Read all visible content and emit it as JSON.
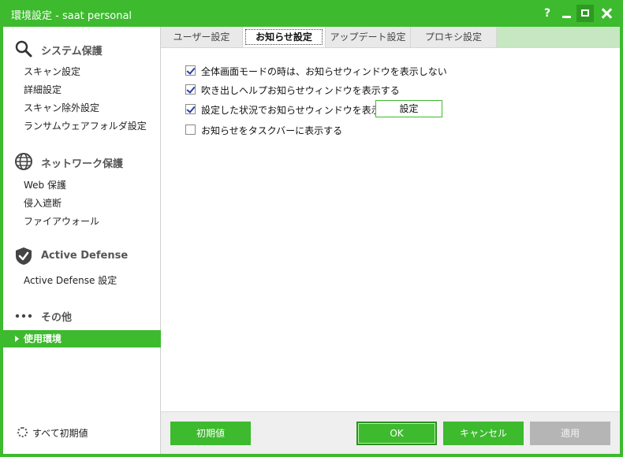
{
  "window": {
    "title": "環境設定 - saat personal",
    "help_label": "?"
  },
  "sidebar": {
    "sections": [
      {
        "label": "システム保護",
        "icon": "search-icon",
        "items": [
          "スキャン設定",
          "詳細設定",
          "スキャン除外設定",
          "ランサムウェアフォルダ設定"
        ]
      },
      {
        "label": "ネットワーク保護",
        "icon": "globe-icon",
        "items": [
          "Web 保護",
          "侵入遮断",
          "ファイアウォール"
        ]
      },
      {
        "label": "Active Defense",
        "icon": "shield-check-icon",
        "items": [
          "Active Defense 設定"
        ]
      },
      {
        "label": "その他",
        "icon": "more-dots-icon",
        "items": [
          "使用環境"
        ]
      }
    ],
    "active_item": "使用環境",
    "reset_all": "すべて初期値"
  },
  "tabs": [
    {
      "label": "ユーザー設定",
      "active": false
    },
    {
      "label": "お知らせ設定",
      "active": true
    },
    {
      "label": "アップデート設定",
      "active": false
    },
    {
      "label": "プロキシ設定",
      "active": false
    }
  ],
  "options": [
    {
      "label": "全体画面モードの時は、お知らせウィンドウを表示しない",
      "checked": true
    },
    {
      "label": "吹き出しヘルプお知らせウィンドウを表示する",
      "checked": true
    },
    {
      "label": "設定した状況でお知らせウィンドウを表示する",
      "checked": true
    },
    {
      "label": "お知らせをタスクバーに表示する",
      "checked": false
    }
  ],
  "settings_button": "設定",
  "footer": {
    "defaults": "初期値",
    "ok": "OK",
    "cancel": "キャンセル",
    "apply": "適用"
  },
  "colors": {
    "accent": "#3dba2e",
    "disabled": "#b5b5b5"
  }
}
